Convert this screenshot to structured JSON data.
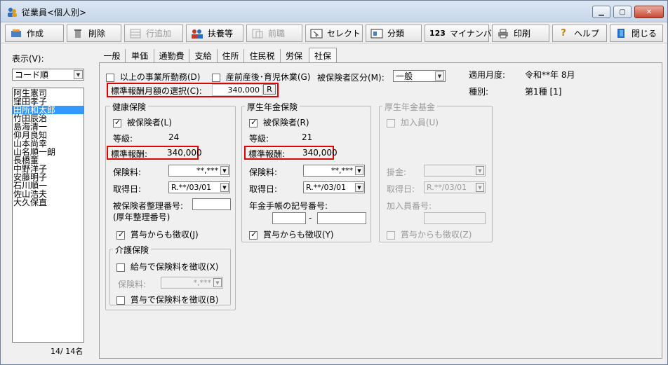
{
  "window": {
    "title": "従業員<個人別>",
    "minimize": "▁",
    "maximize": "▢",
    "close": "✕"
  },
  "toolbar": {
    "create": "作成",
    "delete": "削除",
    "add_row": "行追加",
    "dependents": "扶養等",
    "prev_job": "前職",
    "select": "セレクト",
    "category": "分類",
    "mynumber": "マイナンバー",
    "print": "印刷",
    "help": "ヘルプ",
    "close": "閉じる",
    "mynumber_badge": "123"
  },
  "sidebar": {
    "display_label": "表示(V):",
    "sort_value": "コード順",
    "employees": [
      "阿生憲司",
      "窪田孝子",
      "田所和太郎",
      "竹田辰治",
      "島海清一",
      "仰月良知",
      "山本尚幸",
      "山名順一朗",
      "長橋董",
      "中野洋子",
      "安藤明子",
      "石川順一",
      "佐山浩夫",
      "大久保直"
    ],
    "selected_index": 2,
    "count": "14/  14名"
  },
  "tabs": [
    "一般",
    "単価",
    "通勤費",
    "支給",
    "住所",
    "住民税",
    "労保",
    "社保"
  ],
  "active_tab": 7,
  "top": {
    "multi_office": "以上の事業所勤務(D)",
    "maternity": "産前産後･育児休業(G)",
    "insured_class_label": "被保険者区分(M):",
    "insured_class_value": "一般",
    "apply_month_label": "適用月度:",
    "apply_month_value": "令和**年 8月",
    "type_label": "種別:",
    "type_value": "第1種 [1]",
    "monthly_select_label": "標準報酬月額の選択(C):",
    "monthly_select_value": "340,000",
    "monthly_select_btn": "R"
  },
  "health": {
    "title": "健康保険",
    "insured": "被保険者(L)",
    "grade_label": "等級:",
    "grade_value": "24",
    "std_label": "標準報酬:",
    "std_value": "340,000",
    "premium_label": "保険料:",
    "premium_value": "**,***",
    "acquired_label": "取得日:",
    "acquired_value": "R.**/03/01",
    "insured_no_label": "被保険者整理番号:",
    "insured_no_label2": "(厚年整理番号)",
    "bonus": "賞与からも徴収(J)"
  },
  "care": {
    "title": "介護保険",
    "salary": "給与で保険料を徴収(X)",
    "premium_label": "保険料:",
    "premium_value": "*,***",
    "bonus": "賞与で保険料を徴収(B)"
  },
  "pension": {
    "title": "厚生年金保険",
    "insured": "被保険者(R)",
    "grade_label": "等級:",
    "grade_value": "21",
    "std_label": "標準報酬:",
    "std_value": "340,000",
    "premium_label": "保険料:",
    "premium_value": "**,***",
    "acquired_label": "取得日:",
    "acquired_value": "R.**/03/01",
    "book_label": "年金手帳の記号番号:",
    "dash": "-",
    "bonus": "賞与からも徴収(Y)"
  },
  "fund": {
    "title": "厚生年金基金",
    "member": "加入員(U)",
    "premium_label": "掛金:",
    "acquired_label": "取得日:",
    "acquired_value": "R.**/03/01",
    "member_no_label": "加入員番号:",
    "bonus": "賞与からも徴収(Z)"
  }
}
